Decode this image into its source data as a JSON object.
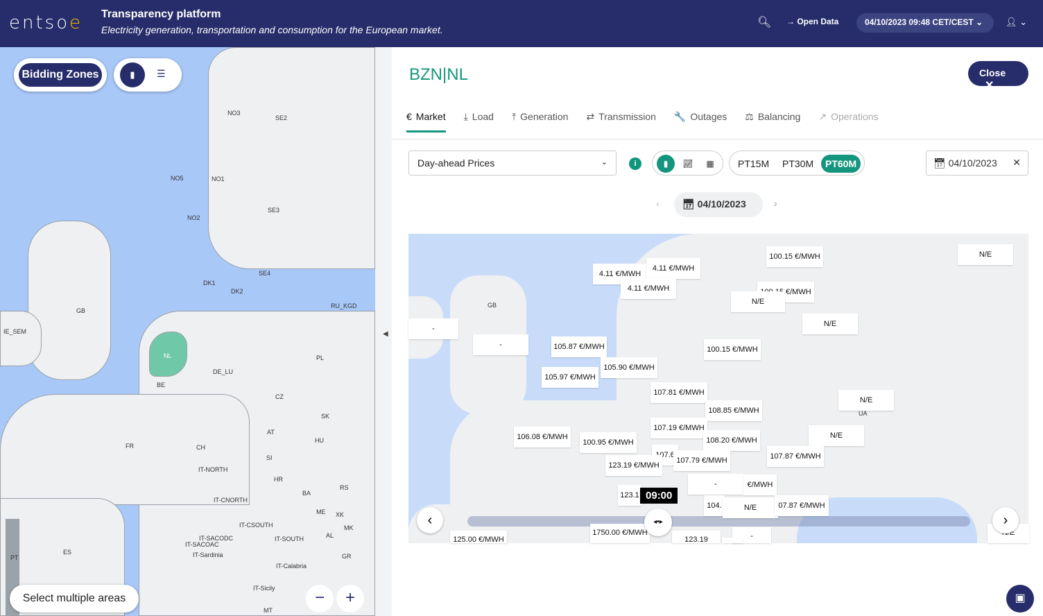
{
  "header": {
    "logo": "entso",
    "logo_e": "e",
    "title": "Transparency platform",
    "subtitle": "Electricity generation, transportation and consumption for the European market.",
    "open_data": "Open Data",
    "datetime": "04/10/2023 09:48 CET/CEST"
  },
  "left_map": {
    "bidding_zones": "Bidding Zones",
    "select_multiple": "Select multiple areas",
    "zoom_out": "−",
    "zoom_in": "+",
    "labels": [
      "NO3",
      "SE2",
      "NO5",
      "NO1",
      "SE3",
      "NO2",
      "SE4",
      "DK1",
      "DK2",
      "RU_KGD",
      "GB",
      "IE_SEM",
      "NL",
      "BE",
      "DE_LU",
      "PL",
      "CZ",
      "SK",
      "AT",
      "HU",
      "FR",
      "CH",
      "SI",
      "IT-NORTH",
      "HR",
      "RS",
      "BA",
      "IT-CNORTH",
      "ME",
      "XK",
      "IT-CSOUTH",
      "MK",
      "IT-SACODC",
      "IT-SACOAC",
      "IT-SOUTH",
      "AL",
      "IT-Sardinia",
      "GR",
      "ES",
      "PT",
      "IT-Calabria",
      "IT-Sicily",
      "MT"
    ]
  },
  "panel": {
    "title": "BZN|NL",
    "close": "Close",
    "tabs": [
      {
        "label": "Market",
        "icon": "€"
      },
      {
        "label": "Load",
        "icon": "⤓"
      },
      {
        "label": "Generation",
        "icon": "⤒"
      },
      {
        "label": "Transmission",
        "icon": "⇄"
      },
      {
        "label": "Outages",
        "icon": "🔧"
      },
      {
        "label": "Balancing",
        "icon": "⚖"
      },
      {
        "label": "Operations",
        "icon": "↗"
      }
    ],
    "dataset": "Day-ahead Prices",
    "resolutions": [
      "PT15M",
      "PT30M",
      "PT60M"
    ],
    "selected_resolution": "PT60M",
    "date_filter": "04/10/2023",
    "date_nav": "04/10/2023"
  },
  "price_map": {
    "time": "09:00",
    "labels": [
      "N/E",
      "100.15 €/MWH",
      "4.11 €/MWH",
      "4.11 €/MWH",
      "4.11 €/MWH",
      "100.15 €/MWH",
      "N/E",
      "-",
      "N/E",
      "-",
      "105.87 €/MWH",
      "100.15 €/MWH",
      "105.90 €/MWH",
      "105.97 €/MWH",
      "107.81 €/MWH",
      "N/E",
      "108.85 €/MWH",
      "107.19 €/MWH",
      "106.08 €/MWH",
      "100.95 €/MWH",
      "108.20 €/MWH",
      "N/E",
      "107.6",
      "107.79 €/MWH",
      "107.87 €/MWH",
      "123.19 €/MWH",
      "-",
      "€/MWH",
      "123.1",
      "104.",
      "N/E",
      "07.87 €/MWH",
      "1750.00 €/MWH",
      "125.00 €/MWH",
      "123.19 €/MWH",
      "-",
      "-",
      "N/E"
    ],
    "map_labels": [
      "GB",
      "UA"
    ]
  },
  "colors": {
    "navy": "#262d6a",
    "teal": "#14967e",
    "sea": "#a8c8f8"
  }
}
